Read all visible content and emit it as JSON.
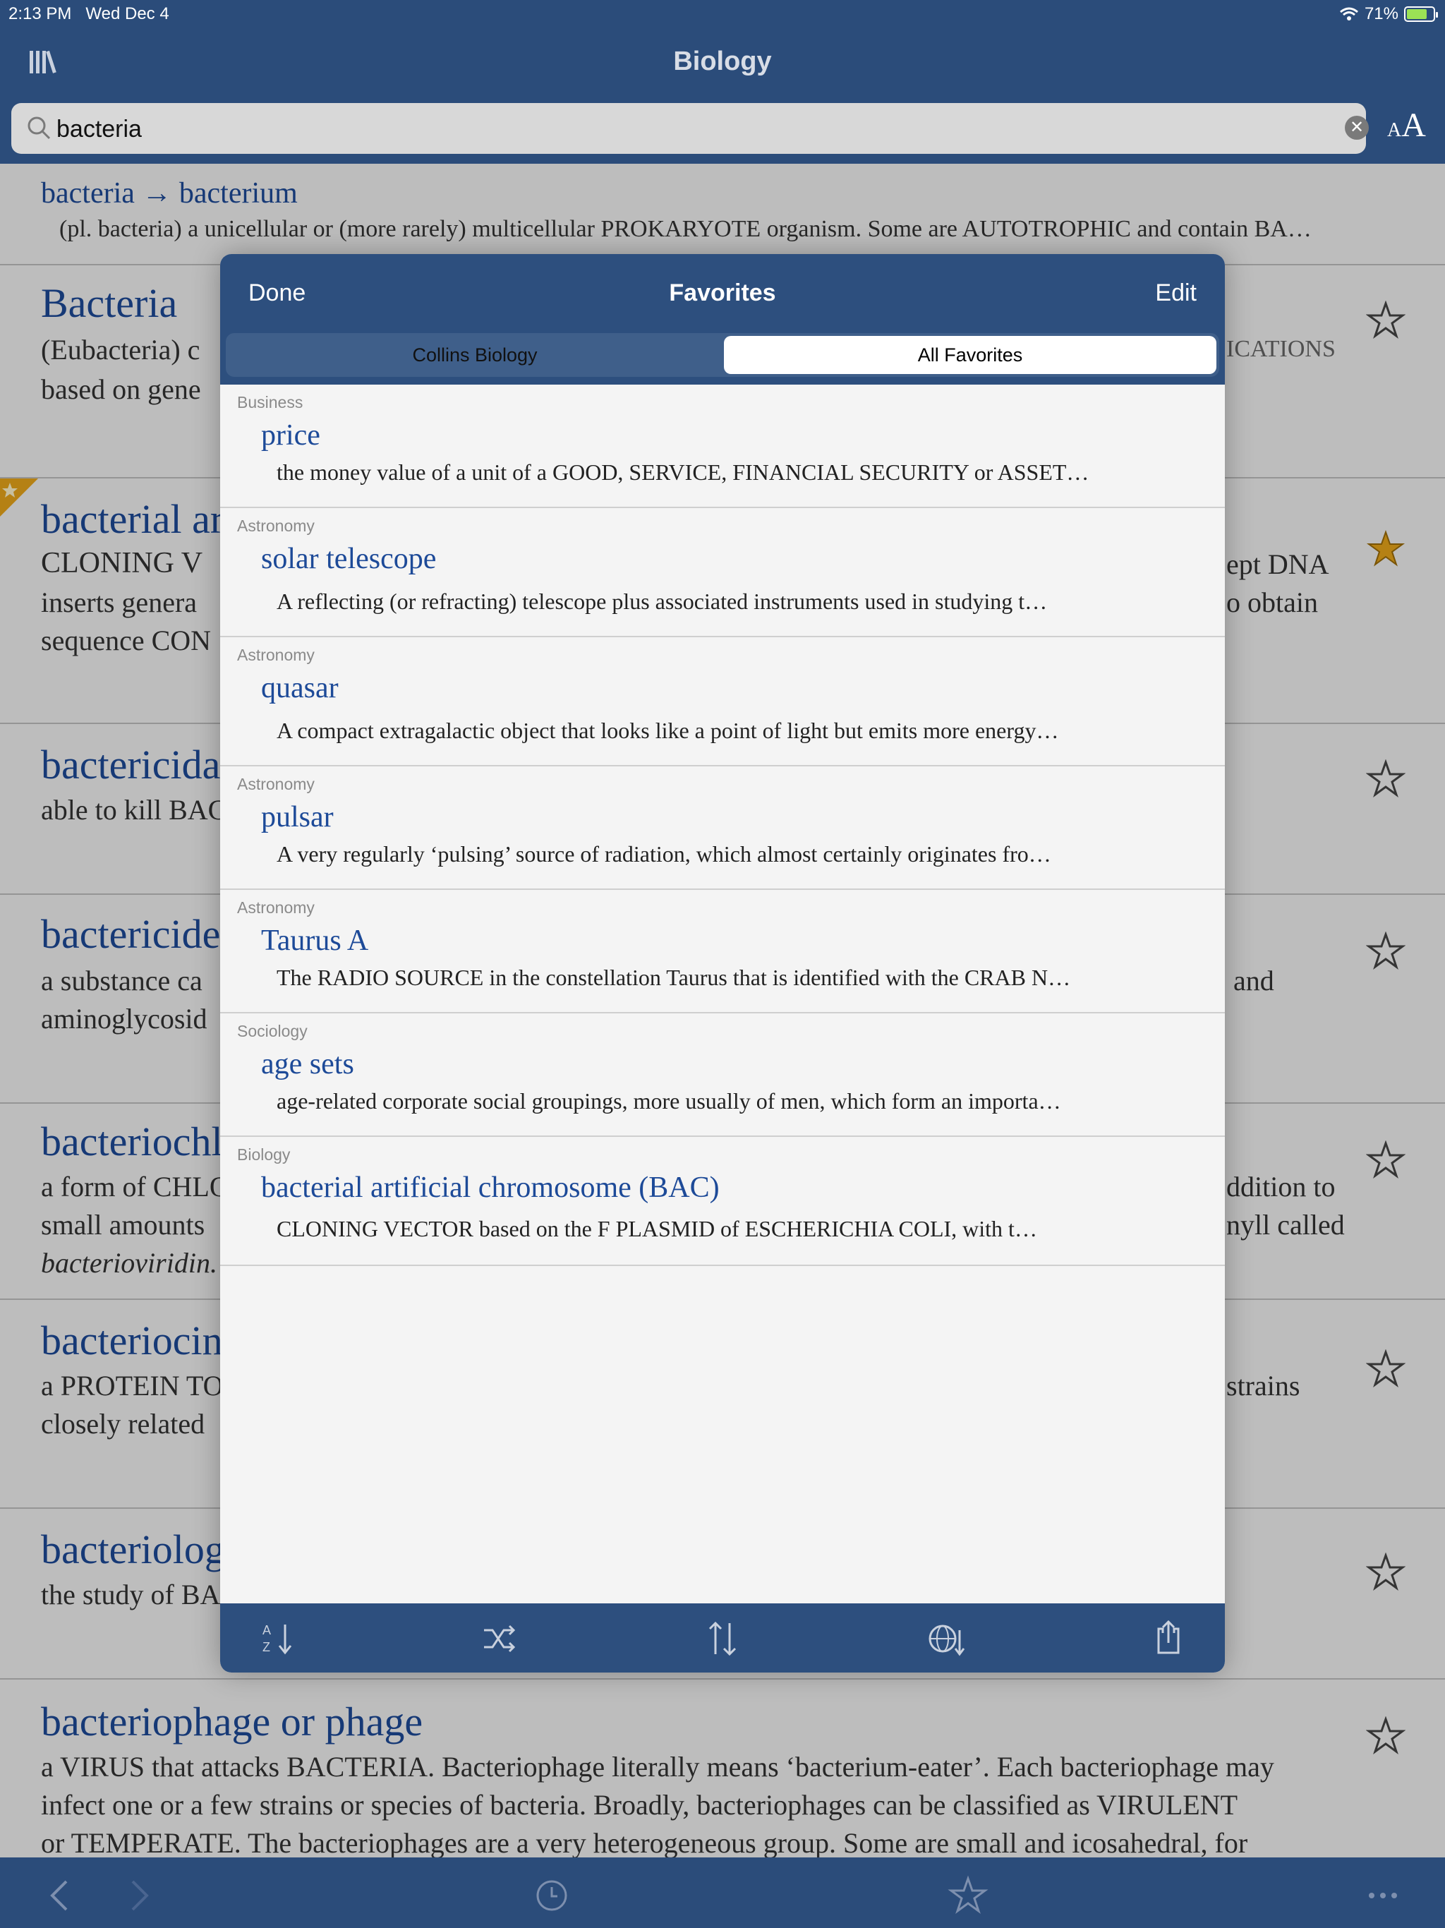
{
  "status_bar": {
    "time": "2:13 PM",
    "date": "Wed Dec 4",
    "battery": "71%"
  },
  "header": {
    "title": "Biology",
    "font_size_small": "A",
    "font_size_large": "A"
  },
  "search": {
    "value": "bacteria",
    "placeholder": ""
  },
  "background_entries": [
    {
      "term": "bacteria → bacterium",
      "line1": "(pl. bacteria) a unicellular or (more rarely) multicellular PROKARYOTE organism. Some are AUTOTROPHIC and contain BA…",
      "starred": false
    },
    {
      "term": "Bacteria",
      "line1": "(Eubacteria) c",
      "line2": "based on gene",
      "right1": "ICATIONS",
      "starred": false
    },
    {
      "term": "bacterial ar",
      "line1": "CLONING V",
      "line2": "inserts genera",
      "line3": "sequence CON",
      "right1": "ept DNA",
      "right2": "o obtain",
      "starred": true
    },
    {
      "term": "bactericida",
      "line1": "able to kill BAC",
      "starred": false
    },
    {
      "term": "bactericide",
      "line1": "a substance ca",
      "line2": "aminoglycosid",
      "right1": "and",
      "starred": false
    },
    {
      "term": "bacteriochl",
      "line1": "a form of CHLO",
      "line2": "small amounts",
      "line3": "bacterioviridin.",
      "right1": "ddition to",
      "right2": "nyll called",
      "starred": false
    },
    {
      "term": "bacteriocin",
      "line1": "a PROTEIN TOX",
      "line2": "closely related",
      "right1": "strains",
      "starred": false
    },
    {
      "term": "bacteriolog",
      "line1": "the study of BA",
      "starred": false
    },
    {
      "term": "bacteriophage or phage",
      "line1": "a VIRUS that attacks BACTERIA. Bacteriophage literally means ‘bacterium-eater’. Each bacteriophage may",
      "line2": "infect one or a few strains or species of bacteria. Broadly, bacteriophages can be classified as VIRULENT",
      "line3": "or TEMPERATE. The bacteriophages are a very heterogeneous group. Some are small and icosahedral, for",
      "starred": false
    }
  ],
  "modal": {
    "done_label": "Done",
    "title": "Favorites",
    "edit_label": "Edit",
    "segments": {
      "collins": "Collins Biology",
      "all": "All Favorites",
      "selected": "All Favorites"
    },
    "favorites": [
      {
        "category": "Business",
        "term": "price",
        "definition": "the money value of a unit of a GOOD, SERVICE, FINANCIAL SECURITY or ASSET…"
      },
      {
        "category": "Astronomy",
        "term": "solar telescope",
        "definition": "A reflecting (or refracting) telescope plus associated instruments used in studying t…"
      },
      {
        "category": "Astronomy",
        "term": "quasar",
        "definition": "A compact extragalactic object that looks like a point of light but emits more energy…"
      },
      {
        "category": "Astronomy",
        "term": "pulsar",
        "definition": "A very regularly ‘pulsing’ source of radiation, which almost certainly originates fro…"
      },
      {
        "category": "Astronomy",
        "term": "Taurus A",
        "definition": "The RADIO SOURCE in the constellation Taurus that is identified with the CRAB N…"
      },
      {
        "category": "Sociology",
        "term": "age sets",
        "definition": "age-related corporate social groupings, more usually of men, which form an importa…"
      },
      {
        "category": "Biology",
        "term": "bacterial artificial chromosome (BAC)",
        "definition": "CLONING VECTOR based on the F PLASMID of ESCHERICHIA COLI, with t…"
      }
    ],
    "toolbar": [
      "sort-az-icon",
      "shuffle-icon",
      "sort-order-icon",
      "sort-by-language-icon",
      "share-icon"
    ]
  },
  "bottom_toolbar": [
    "back-icon",
    "forward-icon",
    "history-icon",
    "favorites-icon",
    "more-icon"
  ],
  "colors": {
    "bar": "#2b4c7a",
    "link": "#1d4a98",
    "star_active": "#e8a61a"
  }
}
